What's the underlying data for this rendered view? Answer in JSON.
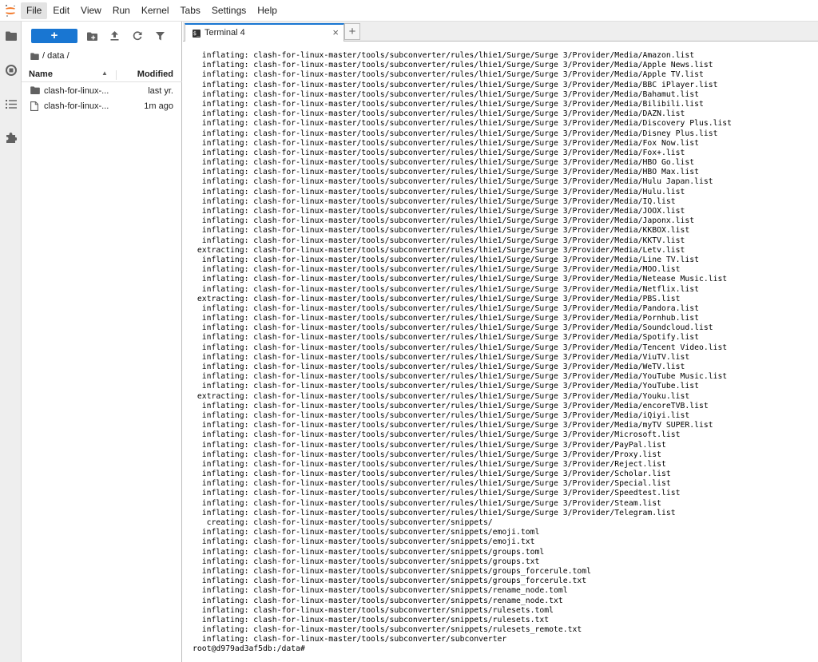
{
  "menubar": {
    "logo_icon": "jupyter-logo",
    "items": [
      "File",
      "Edit",
      "View",
      "Run",
      "Kernel",
      "Tabs",
      "Settings",
      "Help"
    ],
    "active_index": 0
  },
  "activity_bar": {
    "items": [
      {
        "name": "folder-icon"
      },
      {
        "name": "running-icon"
      },
      {
        "name": "toc-icon"
      },
      {
        "name": "extension-icon"
      }
    ]
  },
  "file_browser": {
    "new_label": "+",
    "breadcrumb": "/ data /",
    "columns": {
      "name": "Name",
      "modified": "Modified"
    },
    "rows": [
      {
        "type": "folder",
        "name": "clash-for-linux-...",
        "modified": "last yr."
      },
      {
        "type": "file",
        "name": "clash-for-linux-...",
        "modified": "1m ago"
      }
    ]
  },
  "tabs": [
    {
      "title": "Terminal 4",
      "close": "×"
    }
  ],
  "add_tab_label": "+",
  "terminal": {
    "lines": [
      "  inflating: clash-for-linux-master/tools/subconverter/rules/lhie1/Surge/Surge 3/Provider/Media/Amazon.list",
      "  inflating: clash-for-linux-master/tools/subconverter/rules/lhie1/Surge/Surge 3/Provider/Media/Apple News.list",
      "  inflating: clash-for-linux-master/tools/subconverter/rules/lhie1/Surge/Surge 3/Provider/Media/Apple TV.list",
      "  inflating: clash-for-linux-master/tools/subconverter/rules/lhie1/Surge/Surge 3/Provider/Media/BBC iPlayer.list",
      "  inflating: clash-for-linux-master/tools/subconverter/rules/lhie1/Surge/Surge 3/Provider/Media/Bahamut.list",
      "  inflating: clash-for-linux-master/tools/subconverter/rules/lhie1/Surge/Surge 3/Provider/Media/Bilibili.list",
      "  inflating: clash-for-linux-master/tools/subconverter/rules/lhie1/Surge/Surge 3/Provider/Media/DAZN.list",
      "  inflating: clash-for-linux-master/tools/subconverter/rules/lhie1/Surge/Surge 3/Provider/Media/Discovery Plus.list",
      "  inflating: clash-for-linux-master/tools/subconverter/rules/lhie1/Surge/Surge 3/Provider/Media/Disney Plus.list",
      "  inflating: clash-for-linux-master/tools/subconverter/rules/lhie1/Surge/Surge 3/Provider/Media/Fox Now.list",
      "  inflating: clash-for-linux-master/tools/subconverter/rules/lhie1/Surge/Surge 3/Provider/Media/Fox+.list",
      "  inflating: clash-for-linux-master/tools/subconverter/rules/lhie1/Surge/Surge 3/Provider/Media/HBO Go.list",
      "  inflating: clash-for-linux-master/tools/subconverter/rules/lhie1/Surge/Surge 3/Provider/Media/HBO Max.list",
      "  inflating: clash-for-linux-master/tools/subconverter/rules/lhie1/Surge/Surge 3/Provider/Media/Hulu Japan.list",
      "  inflating: clash-for-linux-master/tools/subconverter/rules/lhie1/Surge/Surge 3/Provider/Media/Hulu.list",
      "  inflating: clash-for-linux-master/tools/subconverter/rules/lhie1/Surge/Surge 3/Provider/Media/IQ.list",
      "  inflating: clash-for-linux-master/tools/subconverter/rules/lhie1/Surge/Surge 3/Provider/Media/JOOX.list",
      "  inflating: clash-for-linux-master/tools/subconverter/rules/lhie1/Surge/Surge 3/Provider/Media/Japonx.list",
      "  inflating: clash-for-linux-master/tools/subconverter/rules/lhie1/Surge/Surge 3/Provider/Media/KKBOX.list",
      "  inflating: clash-for-linux-master/tools/subconverter/rules/lhie1/Surge/Surge 3/Provider/Media/KKTV.list",
      " extracting: clash-for-linux-master/tools/subconverter/rules/lhie1/Surge/Surge 3/Provider/Media/Letv.list",
      "  inflating: clash-for-linux-master/tools/subconverter/rules/lhie1/Surge/Surge 3/Provider/Media/Line TV.list",
      "  inflating: clash-for-linux-master/tools/subconverter/rules/lhie1/Surge/Surge 3/Provider/Media/MOO.list",
      "  inflating: clash-for-linux-master/tools/subconverter/rules/lhie1/Surge/Surge 3/Provider/Media/Netease Music.list",
      "  inflating: clash-for-linux-master/tools/subconverter/rules/lhie1/Surge/Surge 3/Provider/Media/Netflix.list",
      " extracting: clash-for-linux-master/tools/subconverter/rules/lhie1/Surge/Surge 3/Provider/Media/PBS.list",
      "  inflating: clash-for-linux-master/tools/subconverter/rules/lhie1/Surge/Surge 3/Provider/Media/Pandora.list",
      "  inflating: clash-for-linux-master/tools/subconverter/rules/lhie1/Surge/Surge 3/Provider/Media/Pornhub.list",
      "  inflating: clash-for-linux-master/tools/subconverter/rules/lhie1/Surge/Surge 3/Provider/Media/Soundcloud.list",
      "  inflating: clash-for-linux-master/tools/subconverter/rules/lhie1/Surge/Surge 3/Provider/Media/Spotify.list",
      "  inflating: clash-for-linux-master/tools/subconverter/rules/lhie1/Surge/Surge 3/Provider/Media/Tencent Video.list",
      "  inflating: clash-for-linux-master/tools/subconverter/rules/lhie1/Surge/Surge 3/Provider/Media/ViuTV.list",
      "  inflating: clash-for-linux-master/tools/subconverter/rules/lhie1/Surge/Surge 3/Provider/Media/WeTV.list",
      "  inflating: clash-for-linux-master/tools/subconverter/rules/lhie1/Surge/Surge 3/Provider/Media/YouTube Music.list",
      "  inflating: clash-for-linux-master/tools/subconverter/rules/lhie1/Surge/Surge 3/Provider/Media/YouTube.list",
      " extracting: clash-for-linux-master/tools/subconverter/rules/lhie1/Surge/Surge 3/Provider/Media/Youku.list",
      "  inflating: clash-for-linux-master/tools/subconverter/rules/lhie1/Surge/Surge 3/Provider/Media/encoreTVB.list",
      "  inflating: clash-for-linux-master/tools/subconverter/rules/lhie1/Surge/Surge 3/Provider/Media/iQiyi.list",
      "  inflating: clash-for-linux-master/tools/subconverter/rules/lhie1/Surge/Surge 3/Provider/Media/myTV SUPER.list",
      "  inflating: clash-for-linux-master/tools/subconverter/rules/lhie1/Surge/Surge 3/Provider/Microsoft.list",
      "  inflating: clash-for-linux-master/tools/subconverter/rules/lhie1/Surge/Surge 3/Provider/PayPal.list",
      "  inflating: clash-for-linux-master/tools/subconverter/rules/lhie1/Surge/Surge 3/Provider/Proxy.list",
      "  inflating: clash-for-linux-master/tools/subconverter/rules/lhie1/Surge/Surge 3/Provider/Reject.list",
      "  inflating: clash-for-linux-master/tools/subconverter/rules/lhie1/Surge/Surge 3/Provider/Scholar.list",
      "  inflating: clash-for-linux-master/tools/subconverter/rules/lhie1/Surge/Surge 3/Provider/Special.list",
      "  inflating: clash-for-linux-master/tools/subconverter/rules/lhie1/Surge/Surge 3/Provider/Speedtest.list",
      "  inflating: clash-for-linux-master/tools/subconverter/rules/lhie1/Surge/Surge 3/Provider/Steam.list",
      "  inflating: clash-for-linux-master/tools/subconverter/rules/lhie1/Surge/Surge 3/Provider/Telegram.list",
      "   creating: clash-for-linux-master/tools/subconverter/snippets/",
      "  inflating: clash-for-linux-master/tools/subconverter/snippets/emoji.toml",
      "  inflating: clash-for-linux-master/tools/subconverter/snippets/emoji.txt",
      "  inflating: clash-for-linux-master/tools/subconverter/snippets/groups.toml",
      "  inflating: clash-for-linux-master/tools/subconverter/snippets/groups.txt",
      "  inflating: clash-for-linux-master/tools/subconverter/snippets/groups_forcerule.toml",
      "  inflating: clash-for-linux-master/tools/subconverter/snippets/groups_forcerule.txt",
      "  inflating: clash-for-linux-master/tools/subconverter/snippets/rename_node.toml",
      "  inflating: clash-for-linux-master/tools/subconverter/snippets/rename_node.txt",
      "  inflating: clash-for-linux-master/tools/subconverter/snippets/rulesets.toml",
      "  inflating: clash-for-linux-master/tools/subconverter/snippets/rulesets.txt",
      "  inflating: clash-for-linux-master/tools/subconverter/snippets/rulesets_remote.txt",
      "  inflating: clash-for-linux-master/tools/subconverter/subconverter",
      "root@d979ad3af5db:/data#"
    ]
  },
  "colors": {
    "accent": "#1976d2",
    "menubar_active": "#e3e3e3",
    "activity_bg": "#eeeeee",
    "jupyter_orange": "#f37726"
  }
}
